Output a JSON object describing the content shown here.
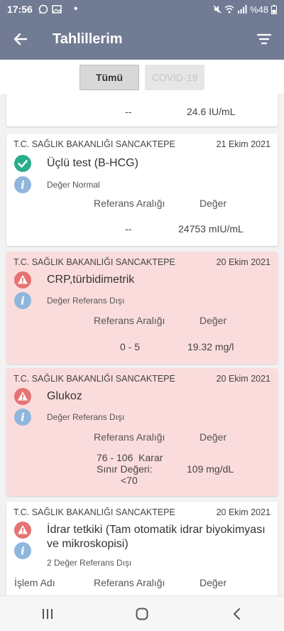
{
  "status": {
    "time": "17:56",
    "battery": "%48"
  },
  "appbar": {
    "title": "Tahlillerim"
  },
  "tabs": [
    {
      "label": "Tümü"
    },
    {
      "label": "COVID-19"
    }
  ],
  "partial": {
    "range": "--",
    "value": "24.6 IU/mL"
  },
  "cols": {
    "process": "İşlem Adı",
    "range": "Referans Aralığı",
    "value": "Değer"
  },
  "cards": [
    {
      "institution": "T.C. SAĞLIK BAKANLIĞI SANCAKTEPE",
      "date": "21 Ekim 2021",
      "test": "Üçlü test (B-HCG)",
      "note": "Değer Normal",
      "range": "--",
      "value": "24753 mIU/mL"
    },
    {
      "institution": "T.C. SAĞLIK BAKANLIĞI SANCAKTEPE",
      "date": "20 Ekim 2021",
      "test": "CRP,türbidimetrik",
      "note": "Değer Referans Dışı",
      "range": "0 - 5",
      "value": "19.32 mg/l"
    },
    {
      "institution": "T.C. SAĞLIK BAKANLIĞI SANCAKTEPE",
      "date": "20 Ekim 2021",
      "test": "Glukoz",
      "note": "Değer Referans Dışı",
      "range_l1": "76 - 106  Karar",
      "range_l2": "Sınır Değeri:",
      "range_l3": "<70",
      "value": "109 mg/dL"
    },
    {
      "institution": "T.C. SAĞLIK BAKANLIĞI SANCAKTEPE",
      "date": "20 Ekim 2021",
      "test_l1": "İdrar tetkiki (Tam otomatik idrar biyokimyası",
      "test_l2": "ve mikroskopisi)",
      "note": "2 Değer Referans Dışı"
    }
  ],
  "colors": {
    "header": "#727b94",
    "alert_card": "#fbdcdc",
    "ok_icon": "#27ae8a",
    "warn_icon": "#e57373",
    "info_icon": "#8fb6dc"
  }
}
